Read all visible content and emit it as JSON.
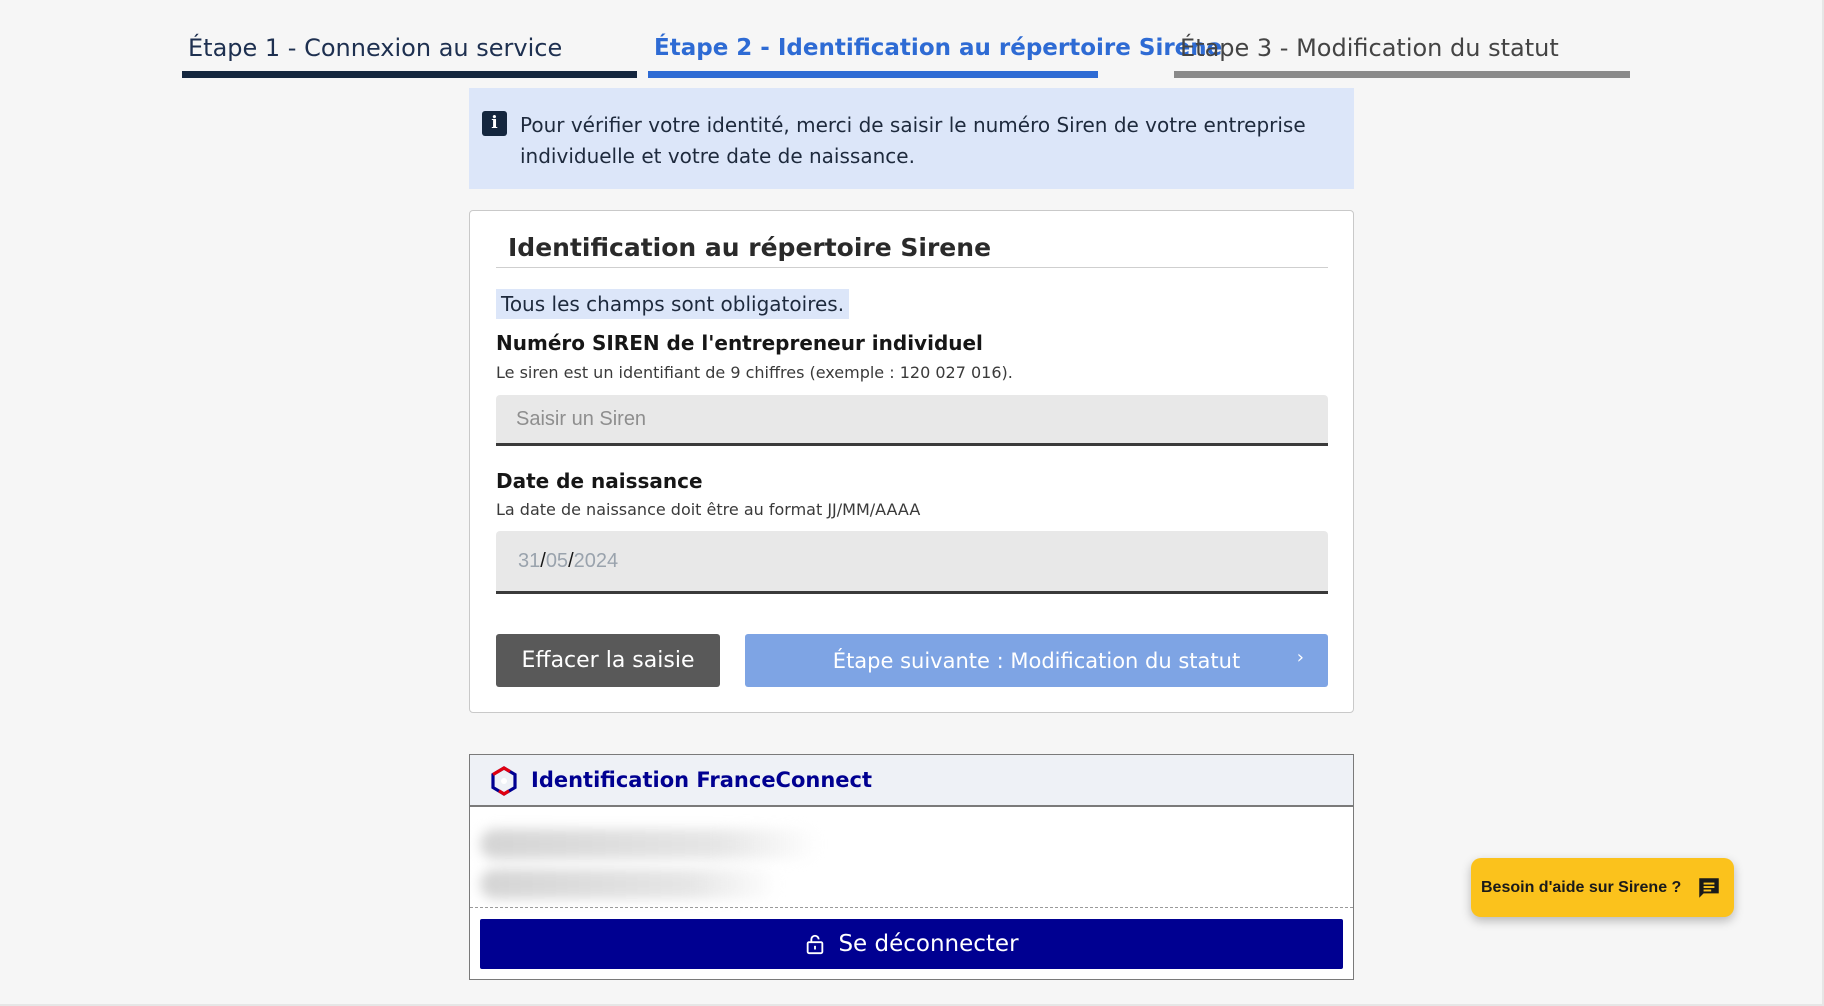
{
  "stepper": {
    "steps": [
      {
        "label": "Étape 1 - Connexion au service",
        "state": "completed",
        "color": "#14263e"
      },
      {
        "label": "Étape 2 - Identification au répertoire Sirene",
        "state": "current",
        "color": "#2e6bd4"
      },
      {
        "label": "Étape 3 - Modification du statut",
        "state": "upcoming",
        "color": "#8a8a8a"
      }
    ]
  },
  "info_alert": {
    "icon": "info-icon",
    "text": "Pour vérifier votre identité, merci de saisir le numéro Siren de votre entreprise individuelle et votre date de naissance."
  },
  "form": {
    "title": "Identification au répertoire Sirene",
    "required_note": "Tous les champs sont obligatoires.",
    "siren": {
      "label": "Numéro SIREN de l'entrepreneur individuel",
      "hint": "Le siren est un identifiant de 9 chiffres (exemple : 120 027 016).",
      "placeholder": "Saisir un Siren",
      "value": ""
    },
    "birthdate": {
      "label": "Date de naissance",
      "hint": "La date de naissance doit être au format JJ/MM/AAAA",
      "day": "31",
      "month": "05",
      "year": "2024",
      "separator": "/"
    },
    "clear_button": "Effacer la saisie",
    "next_button": "Étape suivante : Modification du statut",
    "next_chevron": "›"
  },
  "franceconnect": {
    "title": "Identification FranceConnect",
    "logout_button": "Se déconnecter",
    "logout_icon": "lock-open-icon"
  },
  "help": {
    "label": "Besoin d'aide sur Sirene ?",
    "icon": "chat-icon",
    "color": "#fbc21c"
  },
  "colors": {
    "primary_blue": "#000091",
    "accent_blue": "#2e6bd4",
    "info_bg": "#dce6f9"
  }
}
